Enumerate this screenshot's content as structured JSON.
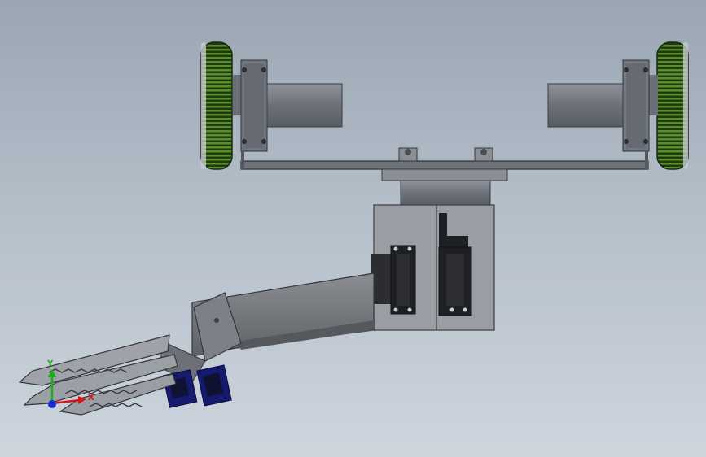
{
  "viewport": {
    "background_top": "#9aa6b3",
    "background_bottom": "#cdd5dd"
  },
  "model": {
    "parts": [
      "left-wheel",
      "right-wheel",
      "left-motor",
      "right-motor",
      "axle-frame",
      "turntable",
      "servo-housing",
      "arm-beam",
      "gripper"
    ]
  },
  "triad": {
    "x_label": "X",
    "y_label": "Y",
    "x_color": "#d01818",
    "y_color": "#18b018",
    "z_color": "#1a2ad0"
  }
}
